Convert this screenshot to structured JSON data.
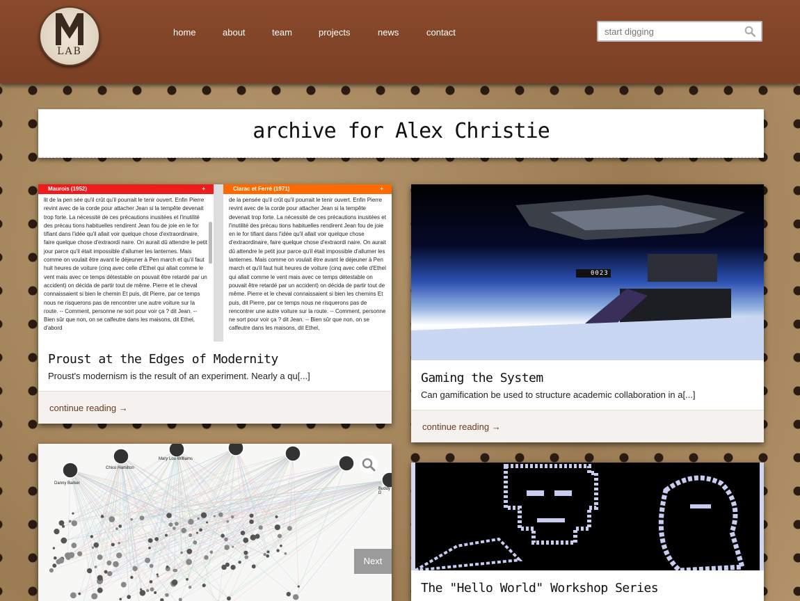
{
  "header": {
    "logo_text": "LAB",
    "nav": [
      {
        "label": "home"
      },
      {
        "label": "about"
      },
      {
        "label": "team"
      },
      {
        "label": "projects"
      },
      {
        "label": "news"
      },
      {
        "label": "contact"
      }
    ],
    "search_placeholder": "start digging",
    "search_icon": "search-icon"
  },
  "page_title": "archive for Alex Christie",
  "posts": [
    {
      "title": "Proust at the Edges of Modernity",
      "excerpt": "Proust's modernism is the result of an experiment. Nearly a qu[...]",
      "link": "continue reading →",
      "thumb": {
        "left_header": "Maurois (1952)",
        "right_header": "Clarac et Ferré (1971)",
        "left_text": "lit de la pen sée qu'il crût qu'il pourrait le tenir ouvert. Enfin Pierre revint avec de la corde pour attacher Jean si la tempête devenait trop forte. La nécessité de ces précautions inusitées et l'inutilité des précau tions habituelles rendirent Jean fou de joie en le for tifiant dans l'idée qu'il allait voir quelque chose d'extraordinaire, faire quelque chose d'extraordi naire. On aurait dû attendre le petit jour parce qu'il était impossible d'allumer les lanternes. Mais comme on voulait être avant le déjeuner à Pen march et qu'il faut huit heures de voiture (cinq avec celle d'Ethel qui allait comme le vent mais avec ce temps détestable on pouvait être retardé par un accident) on décida de partir tout de même. Pierre et le cheval connaissaient si bien le chemin Et puis, dit Pierre, par ce temps nous ne risquerons pas de rencontrer une autre voiture sur la route. -- Comment, personne ne sort pour voir ça ? dit Jean. -- Bien sûr que non, on se calfeutre dans les maisons, dit Ethel, d'abord",
        "right_text": "de la pensée qu'il crût qu'il pourrait le tenir ouvert. Enfin Pierre revint avec de la corde pour attacher Jean si la tempête devenait trop forte. La nécessité de ces précautions inusitées et l'inutilité des précau tions habituelles rendirent Jean fou de joie en le for tifiant dans l'idée qu'il allait voir quelque chose d'extraordinaire, faire quelque chose d'extraordi naire. On aurait dû attendre le petit jour parce qu'il était impossible d'allumer les lanternes. Mais comme on voulait être avant le déjeuner à Pen march et qu'il faut huit heures de voiture (cinq avec celle d'Ethel qui allait comme le vent mais avec ce temps détestable on pouvait être retardé par un accident) on décida de partir tout de même. Pierre et le cheval connaissaient si bien les chemins Et puis, dit Pierre, par ce temps nous ne risquerons pas de rencontrer une autre voiture sur la route. -- Comment, personne ne sort pour voir ça ? dit Jean. -- Bien sûr que non, on se calfeutre dans les maisons, dit Ethel,"
      }
    },
    {
      "title": "Gaming the System",
      "excerpt": "Can gamification be used to structure academic collaboration in a[...]",
      "link": "continue reading →",
      "thumb": {
        "hud_number": "0023"
      }
    },
    {
      "title": "",
      "excerpt": "",
      "link": "",
      "thumb": {
        "node_labels": [
          "Danny Barker",
          "Chico Hamilton",
          "Mary Lou Williams",
          "Buddy D"
        ],
        "next_label": "Next",
        "zoom_icon": "search-icon"
      }
    },
    {
      "title": "The \"Hello World\" Workshop Series",
      "excerpt": "",
      "link": ""
    }
  ],
  "colors": {
    "header": "#7f4328",
    "link": "#6b3a22",
    "left_bar": "#ee1c1c",
    "right_bar": "#ff6a00"
  }
}
